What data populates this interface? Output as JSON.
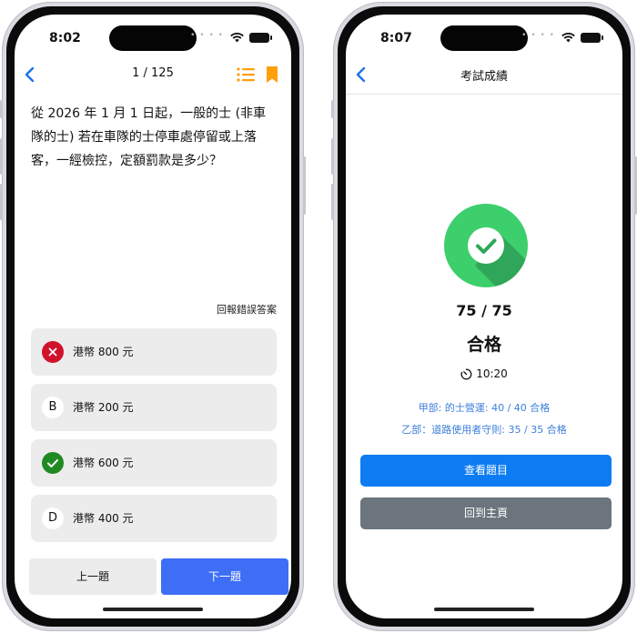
{
  "left_screen": {
    "status_time": "8:02",
    "nav": {
      "title": "1 / 125"
    },
    "question": "從 2026 年 1 月 1 日起，一般的士 (非車隊的士) 若在車隊的士停車處停留或上落客，一經檢控，定額罰款是多少？",
    "report_link": "回報錯誤答案",
    "options": [
      {
        "badge": "",
        "text": "港幣 800 元",
        "state": "wrong"
      },
      {
        "badge": "B",
        "text": "港幣 200 元",
        "state": "normal"
      },
      {
        "badge": "",
        "text": "港幣 600 元",
        "state": "correct"
      },
      {
        "badge": "D",
        "text": "港幣 400 元",
        "state": "normal"
      }
    ],
    "prev_label": "上一題",
    "next_label": "下一題"
  },
  "right_screen": {
    "status_time": "8:07",
    "nav": {
      "title": "考試成績"
    },
    "score": "75 / 75",
    "result": "合格",
    "time_used": "10:20",
    "sections": [
      "甲部: 的士營運: 40 / 40 合格",
      "乙部：道路使用者守則: 35 / 35 合格"
    ],
    "review_label": "查看題目",
    "home_label": "回到主頁"
  },
  "colors": {
    "accent_blue": "#3d6ef5",
    "primary_blue": "#0d7cf2",
    "wrong_red": "#d0132d",
    "correct_green": "#1f8a22",
    "success_circle": "#3ccf6c",
    "bookmark_orange": "#ff9f0a",
    "section_text": "#3b7fd9"
  },
  "icons": [
    "back-chevron-icon",
    "list-icon",
    "bookmark-icon",
    "wifi-icon",
    "battery-icon",
    "close-icon",
    "checkmark-icon",
    "check-circle-icon",
    "timer-icon"
  ]
}
